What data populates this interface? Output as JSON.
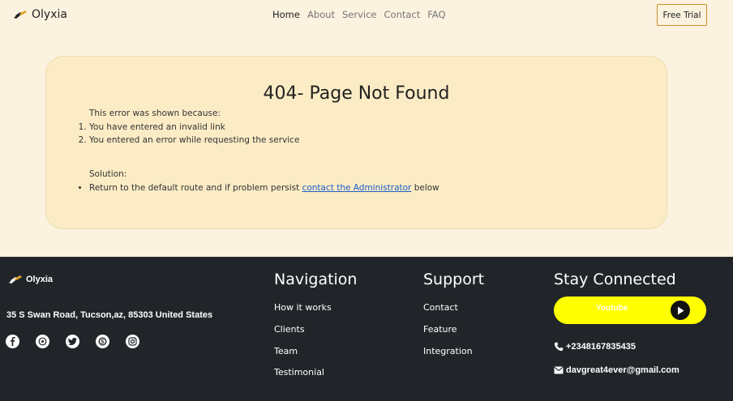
{
  "header": {
    "brand": "Olyxia",
    "nav": [
      {
        "label": "Home"
      },
      {
        "label": "About"
      },
      {
        "label": "Service"
      },
      {
        "label": "Contact"
      },
      {
        "label": "FAQ"
      }
    ],
    "cta_label": "Free Trial"
  },
  "error": {
    "title": "404- Page Not Found",
    "intro": "This error was shown because:",
    "reasons": [
      "You have entered an invalid link",
      "You entered an error while requesting the service"
    ],
    "solution_label": "Solution:",
    "solution_prefix": "Return to the default route and if problem persist ",
    "solution_link": "contact the Administrator",
    "solution_suffix": " below"
  },
  "footer": {
    "brand": "Olyxia",
    "address": "35 S Swan Road, Tucson,az, 85303 United States",
    "social_icons": [
      "facebook-icon",
      "whatsapp-icon",
      "twitter-icon",
      "skype-icon",
      "instagram-icon"
    ],
    "navigation": {
      "title": "Navigation",
      "links": [
        "How it works",
        "Clients",
        "Team",
        "Testimonial"
      ]
    },
    "support": {
      "title": "Support",
      "links": [
        "Contact",
        "Feature",
        "Integration"
      ]
    },
    "connected": {
      "title": "Stay Connected",
      "youtube_label": "Youtube",
      "phone": "+2348167835435",
      "email": "davgreat4ever@gmail.com"
    }
  },
  "colors": {
    "page_bg": "#fbf2df",
    "card_bg": "#fcecc5",
    "footer_bg": "#212529",
    "accent": "#c9922a",
    "youtube_bg": "#ffff00",
    "link": "#1a5dc8"
  }
}
